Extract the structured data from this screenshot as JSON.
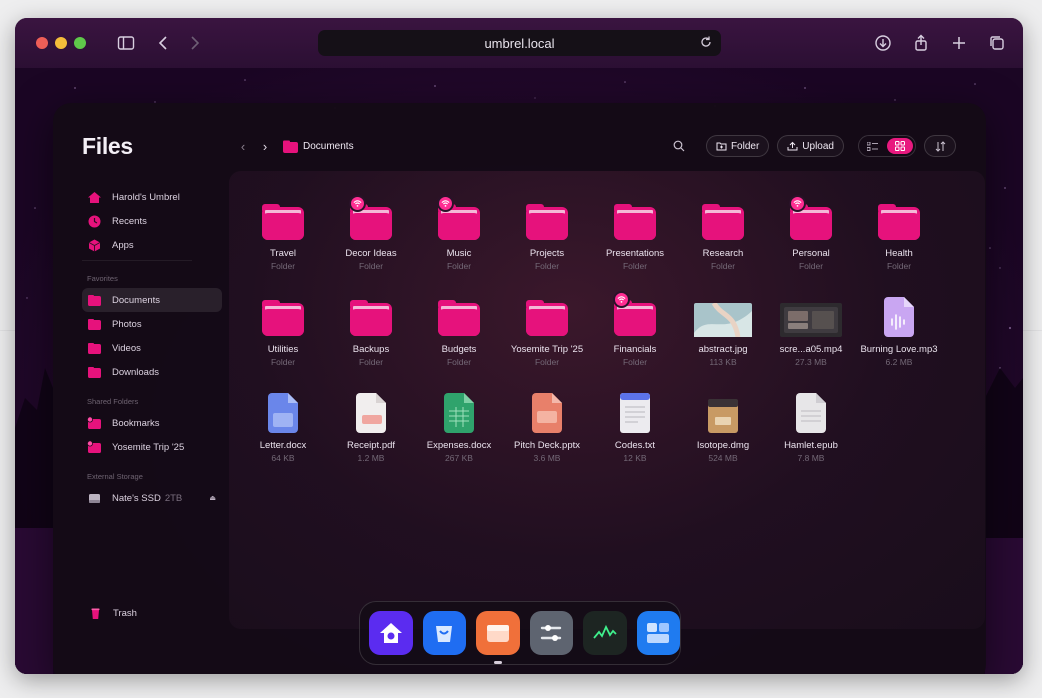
{
  "browser": {
    "url": "umbrel.local"
  },
  "app": {
    "title": "Files"
  },
  "sidebar": {
    "home": [
      {
        "label": "Harold's Umbrel",
        "icon": "home-icon"
      },
      {
        "label": "Recents",
        "icon": "clock-icon"
      },
      {
        "label": "Apps",
        "icon": "cube-icon"
      }
    ],
    "favorites_title": "Favorites",
    "favorites": [
      {
        "label": "Documents",
        "icon": "folder-icon",
        "active": true
      },
      {
        "label": "Photos",
        "icon": "folder-icon"
      },
      {
        "label": "Videos",
        "icon": "folder-icon"
      },
      {
        "label": "Downloads",
        "icon": "folder-icon"
      }
    ],
    "shared_title": "Shared Folders",
    "shared": [
      {
        "label": "Bookmarks",
        "icon": "shared-folder-icon"
      },
      {
        "label": "Yosemite Trip '25",
        "icon": "shared-folder-icon"
      }
    ],
    "external_title": "External Storage",
    "external": [
      {
        "label": "Nate's SSD",
        "size": "2TB",
        "icon": "drive-icon"
      }
    ],
    "trash": "Trash"
  },
  "toolbar": {
    "breadcrumb": "Documents",
    "folder_label": "Folder",
    "upload_label": "Upload"
  },
  "files": [
    {
      "name": "Travel",
      "meta": "Folder",
      "kind": "folder",
      "shared": false
    },
    {
      "name": "Decor Ideas",
      "meta": "Folder",
      "kind": "folder",
      "shared": true
    },
    {
      "name": "Music",
      "meta": "Folder",
      "kind": "folder",
      "shared": true
    },
    {
      "name": "Projects",
      "meta": "Folder",
      "kind": "folder",
      "shared": false
    },
    {
      "name": "Presentations",
      "meta": "Folder",
      "kind": "folder",
      "shared": false
    },
    {
      "name": "Research",
      "meta": "Folder",
      "kind": "folder",
      "shared": false
    },
    {
      "name": "Personal",
      "meta": "Folder",
      "kind": "folder",
      "shared": true
    },
    {
      "name": "Health",
      "meta": "Folder",
      "kind": "folder",
      "shared": false
    },
    {
      "name": "Utilities",
      "meta": "Folder",
      "kind": "folder",
      "shared": false
    },
    {
      "name": "Backups",
      "meta": "Folder",
      "kind": "folder",
      "shared": false
    },
    {
      "name": "Budgets",
      "meta": "Folder",
      "kind": "folder",
      "shared": false
    },
    {
      "name": "Yosemite Trip '25",
      "meta": "Folder",
      "kind": "folder",
      "shared": false
    },
    {
      "name": "Financials",
      "meta": "Folder",
      "kind": "folder",
      "shared": true
    },
    {
      "name": "abstract.jpg",
      "meta": "113 KB",
      "kind": "image",
      "shared": false
    },
    {
      "name": "scre...a05.mp4",
      "meta": "27.3 MB",
      "kind": "video",
      "shared": false
    },
    {
      "name": "Burning Love.mp3",
      "meta": "6.2 MB",
      "kind": "audio",
      "shared": false
    },
    {
      "name": "Letter.docx",
      "meta": "64 KB",
      "kind": "docx",
      "shared": false
    },
    {
      "name": "Receipt.pdf",
      "meta": "1.2 MB",
      "kind": "pdf",
      "shared": false
    },
    {
      "name": "Expenses.docx",
      "meta": "267 KB",
      "kind": "sheet",
      "shared": false
    },
    {
      "name": "Pitch Deck.pptx",
      "meta": "3.6 MB",
      "kind": "pptx",
      "shared": false
    },
    {
      "name": "Codes.txt",
      "meta": "12 KB",
      "kind": "txt",
      "shared": false
    },
    {
      "name": "Isotope.dmg",
      "meta": "524 MB",
      "kind": "dmg",
      "shared": false
    },
    {
      "name": "Hamlet.epub",
      "meta": "7.8 MB",
      "kind": "epub",
      "shared": false
    }
  ],
  "dock": [
    {
      "name": "home-app-icon",
      "color": "#5b2cf0"
    },
    {
      "name": "app-store-icon",
      "color": "#1f6df2"
    },
    {
      "name": "files-app-icon",
      "color": "#f0703a"
    },
    {
      "name": "settings-app-icon",
      "color": "#5e6470"
    },
    {
      "name": "live-usage-app-icon",
      "color": "#1d2522"
    },
    {
      "name": "widgets-app-icon",
      "color": "#1f7bf0"
    }
  ],
  "colors": {
    "accent": "#e8197f",
    "folder": "#e6127c"
  }
}
